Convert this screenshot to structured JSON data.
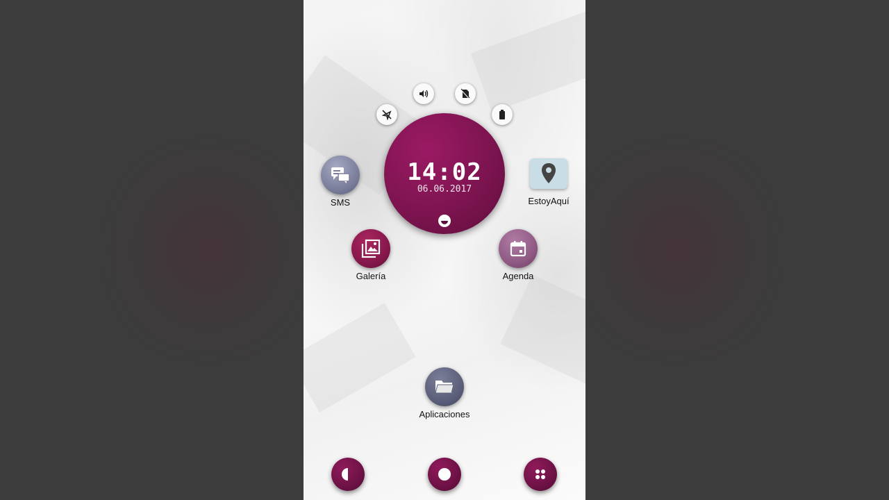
{
  "status_icons": [
    {
      "name": "location-off-icon"
    },
    {
      "name": "volume-icon"
    },
    {
      "name": "no-sim-icon"
    },
    {
      "name": "battery-icon"
    }
  ],
  "clock": {
    "time": "14:02",
    "date": "06.06.2017"
  },
  "apps": {
    "sms": {
      "label": "SMS",
      "icon": "chat-icon"
    },
    "estoyaqui": {
      "label": "EstoyAquí",
      "icon": "map-pin-icon"
    },
    "galeria": {
      "label": "Galería",
      "icon": "gallery-icon"
    },
    "agenda": {
      "label": "Agenda",
      "icon": "calendar-icon"
    },
    "aplicaciones": {
      "label": "Aplicaciones",
      "icon": "folder-icon"
    }
  },
  "dock": [
    {
      "name": "back-button",
      "icon": "half-circle-icon"
    },
    {
      "name": "home-button",
      "icon": "circle-icon"
    },
    {
      "name": "apps-button",
      "icon": "grid-dots-icon"
    }
  ],
  "colors": {
    "accent": "#7d1450",
    "background_outer": "#3d3c3d"
  }
}
